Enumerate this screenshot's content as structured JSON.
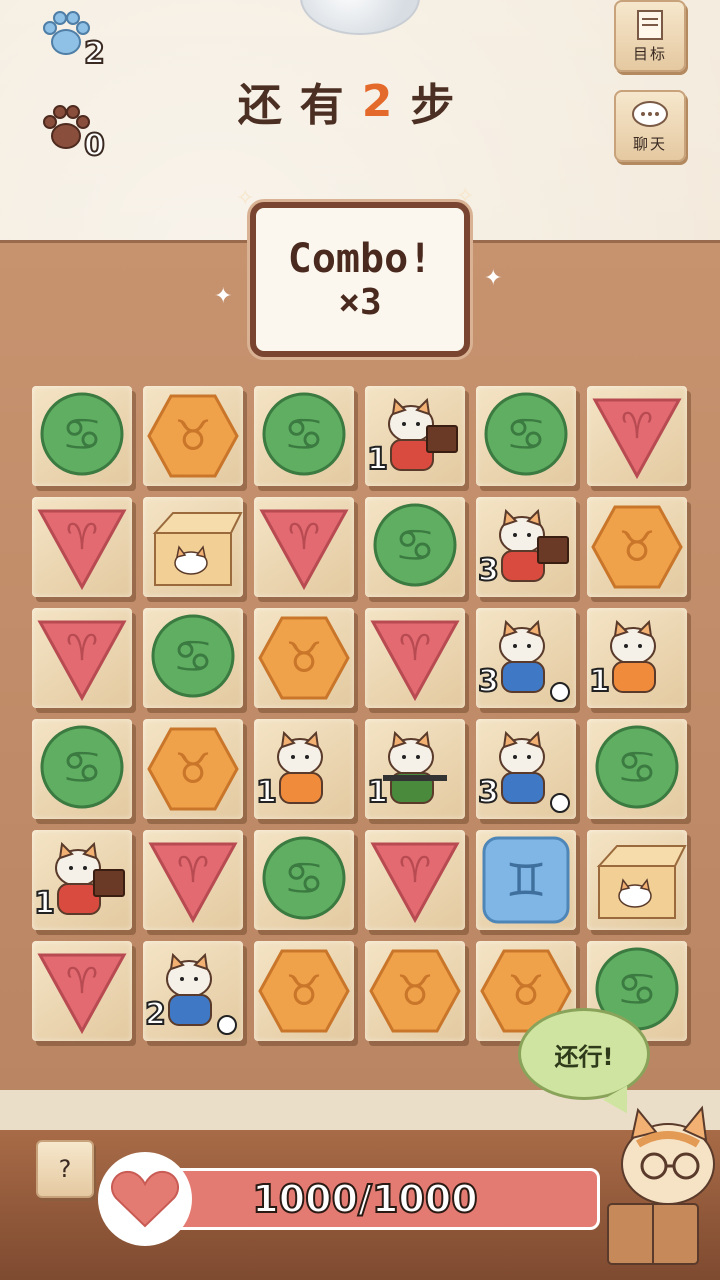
{
  "hud": {
    "blue_paw_count": "2",
    "brown_paw_count": "0",
    "moves_prefix": "还有",
    "moves_value": "2",
    "moves_suffix": "步",
    "goal_label": "目标",
    "chat_label": "聊天"
  },
  "combo": {
    "line1": "Combo!",
    "line2": "×3"
  },
  "speech": "还行!",
  "help_label": "?",
  "health": {
    "text": "1000/1000",
    "fraction": 1.0
  },
  "colors": {
    "green_piece": "#5fae62",
    "red_piece": "#e26a70",
    "orange_piece": "#f0a24a",
    "blue_piece": "#7fb6e6",
    "hp_bar": "#e47b72",
    "moves_highlight": "#e46a2c"
  },
  "board": [
    [
      {
        "type": "green-cancer"
      },
      {
        "type": "orange-taurus"
      },
      {
        "type": "green-cancer"
      },
      {
        "type": "cat-chocolate",
        "count": "1"
      },
      {
        "type": "green-cancer"
      },
      {
        "type": "red-aries"
      }
    ],
    [
      {
        "type": "red-aries"
      },
      {
        "type": "cat-box"
      },
      {
        "type": "red-aries"
      },
      {
        "type": "green-cancer"
      },
      {
        "type": "cat-chocolate",
        "count": "3"
      },
      {
        "type": "orange-taurus"
      }
    ],
    [
      {
        "type": "red-aries"
      },
      {
        "type": "green-cancer"
      },
      {
        "type": "orange-taurus"
      },
      {
        "type": "red-aries"
      },
      {
        "type": "cat-soccer",
        "count": "3"
      },
      {
        "type": "cat-orange",
        "count": "1"
      }
    ],
    [
      {
        "type": "green-cancer"
      },
      {
        "type": "orange-taurus"
      },
      {
        "type": "cat-orange",
        "count": "1"
      },
      {
        "type": "cat-soldier",
        "count": "1"
      },
      {
        "type": "cat-soccer",
        "count": "3"
      },
      {
        "type": "green-cancer"
      }
    ],
    [
      {
        "type": "cat-chocolate",
        "count": "1"
      },
      {
        "type": "red-aries"
      },
      {
        "type": "green-cancer"
      },
      {
        "type": "red-aries"
      },
      {
        "type": "blue-gemini"
      },
      {
        "type": "cat-box"
      }
    ],
    [
      {
        "type": "red-aries"
      },
      {
        "type": "cat-soccer",
        "count": "2"
      },
      {
        "type": "orange-taurus"
      },
      {
        "type": "orange-taurus"
      },
      {
        "type": "orange-taurus"
      },
      {
        "type": "green-cancer"
      }
    ]
  ]
}
